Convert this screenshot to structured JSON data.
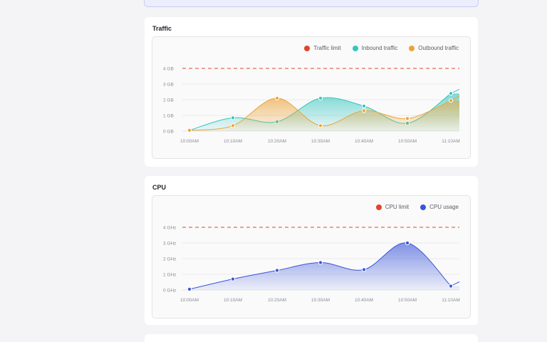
{
  "colors": {
    "limit": "#e0452b",
    "inbound": "#35c6bd",
    "outbound": "#eba438",
    "cpu": "#3a56d9"
  },
  "traffic": {
    "title": "Traffic",
    "legend": {
      "limit": "Traffic limit",
      "inbound": "Inbound traffic",
      "outbound": "Outbound traffic"
    }
  },
  "cpu": {
    "title": "CPU",
    "legend": {
      "limit": "CPU limit",
      "usage": "CPU usage"
    }
  },
  "chart_data": [
    {
      "type": "area",
      "x": [
        "10:00AM",
        "10:10AM",
        "10:20AM",
        "10:30AM",
        "10:40AM",
        "10:50AM",
        "11:10AM"
      ],
      "yticks": [
        "0 GB",
        "1 GB",
        "2 GB",
        "3 GB",
        "4 GB"
      ],
      "ylim": [
        0,
        4
      ],
      "limit": {
        "name": "Traffic limit",
        "value": 4
      },
      "series": [
        {
          "name": "Inbound traffic",
          "values": [
            0.05,
            0.85,
            0.6,
            2.1,
            1.6,
            0.5,
            2.4
          ]
        },
        {
          "name": "Outbound traffic",
          "values": [
            0.05,
            0.35,
            2.1,
            0.35,
            1.3,
            0.8,
            1.95
          ]
        }
      ]
    },
    {
      "type": "area",
      "x": [
        "10:00AM",
        "10:10AM",
        "10:20AM",
        "10:30AM",
        "10:40AM",
        "10:50AM",
        "11:10AM"
      ],
      "yticks": [
        "0 GHz",
        "1 GHz",
        "2 GHz",
        "3 GHz",
        "4 GHz"
      ],
      "ylim": [
        0,
        4
      ],
      "limit": {
        "name": "CPU limit",
        "value": 4
      },
      "series": [
        {
          "name": "CPU usage",
          "values": [
            0.05,
            0.7,
            1.25,
            1.75,
            1.3,
            3.0,
            0.25
          ]
        }
      ]
    }
  ]
}
